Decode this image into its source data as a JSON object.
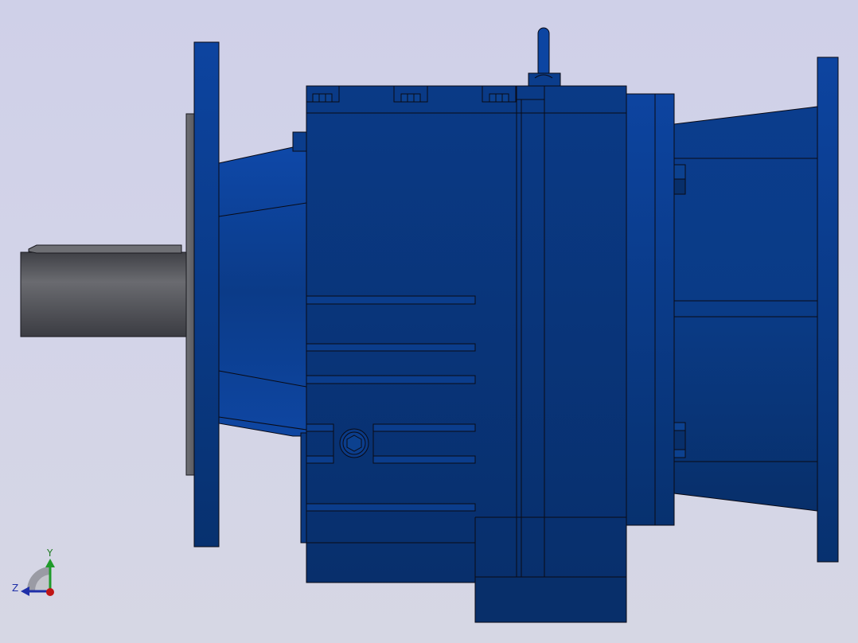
{
  "triad": {
    "y_label": "Y",
    "z_label": "Z"
  },
  "colors": {
    "background": "#d1d2e6",
    "housing_blue": "#0b3b85",
    "housing_dark": "#082f6a",
    "shaft_gray": "#5a5b60",
    "outline": "#0a0a14",
    "axis_y": "#1f9a2a",
    "axis_z": "#1f2fa8",
    "axis_x": "#c01515"
  }
}
